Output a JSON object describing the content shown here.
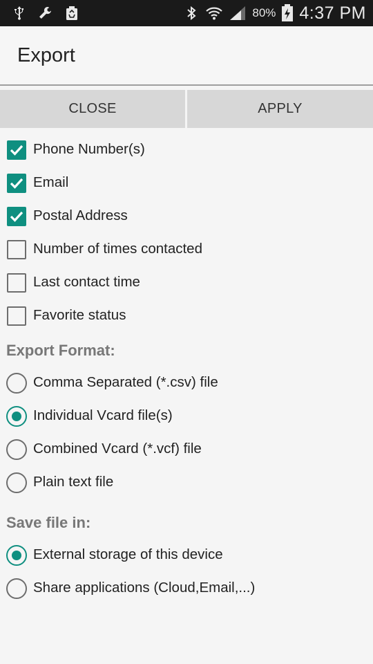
{
  "status_bar": {
    "left_icons": [
      "usb-icon",
      "wrench-icon",
      "recycle-icon"
    ],
    "right_icons": [
      "bluetooth-icon",
      "wifi-icon",
      "signal-icon"
    ],
    "battery_percent": "80%",
    "time": "4:37 PM"
  },
  "header": {
    "title": "Export"
  },
  "buttons": {
    "close": "CLOSE",
    "apply": "APPLY"
  },
  "fields": [
    {
      "label": "Phone Number(s)",
      "checked": true
    },
    {
      "label": "Email",
      "checked": true
    },
    {
      "label": "Postal Address",
      "checked": true
    },
    {
      "label": "Number of times contacted",
      "checked": false
    },
    {
      "label": "Last contact time",
      "checked": false
    },
    {
      "label": "Favorite status",
      "checked": false
    }
  ],
  "export_format": {
    "heading": "Export Format:",
    "options": [
      {
        "label": "Comma Separated (*.csv) file",
        "selected": false
      },
      {
        "label": "Individual Vcard file(s)",
        "selected": true
      },
      {
        "label": "Combined Vcard (*.vcf) file",
        "selected": false
      },
      {
        "label": "Plain text file",
        "selected": false
      }
    ]
  },
  "save_location": {
    "heading": "Save file in:",
    "options": [
      {
        "label": "External storage of this device",
        "selected": true
      },
      {
        "label": "Share applications (Cloud,Email,...)",
        "selected": false
      }
    ]
  },
  "colors": {
    "accent": "#0f8f80",
    "section_heading": "#777777"
  }
}
